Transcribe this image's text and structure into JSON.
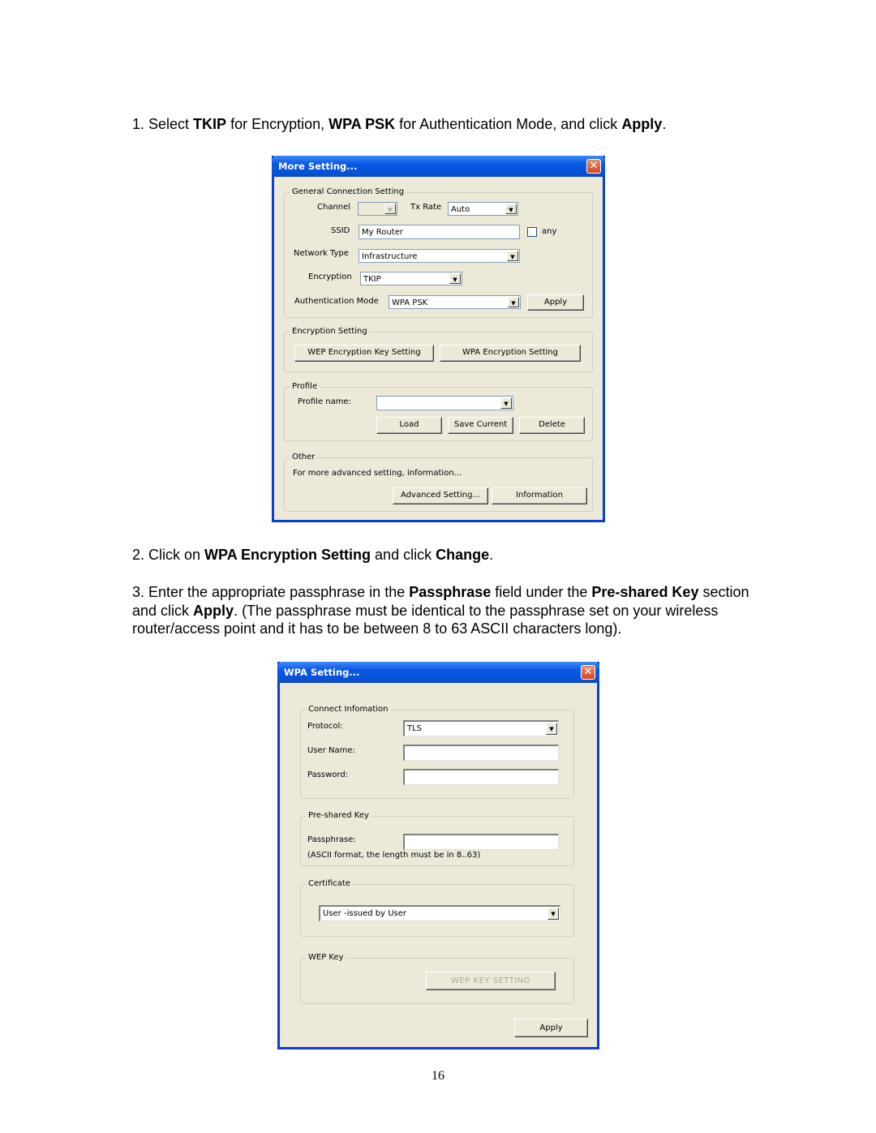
{
  "doc": {
    "step1": {
      "prefix": "1. Select ",
      "b1": "TKIP",
      "t1": " for Encryption, ",
      "b2": "WPA PSK",
      "t2": " for Authentication Mode, and click ",
      "b3": "Apply",
      "t3": "."
    },
    "step2": {
      "prefix": "2. Click on ",
      "b1": "WPA Encryption Setting",
      "t1": " and click ",
      "b2": "Change",
      "t2": "."
    },
    "step3": {
      "prefix": "3. Enter the appropriate passphrase in the ",
      "b1": "Passphrase",
      "t1": " field under the ",
      "b2": "Pre-shared Key",
      "t2": " section and click ",
      "b3": "Apply",
      "t3": ". (The passphrase must be identical to the passphrase set on your wireless router/access point and it has to be between 8 to 63 ASCII characters long)."
    },
    "page_number": "16"
  },
  "more_setting": {
    "title": "More Setting...",
    "close": "✕",
    "general": {
      "label": "General Connection Setting",
      "channel_label": "Channel",
      "channel_value": "",
      "txrate_label": "Tx Rate",
      "txrate_value": "Auto",
      "ssid_label": "SSID",
      "ssid_value": "My Router",
      "any_label": "any",
      "network_type_label": "Network Type",
      "network_type_value": "Infrastructure",
      "encryption_label": "Encryption",
      "encryption_value": "TKIP",
      "auth_label": "Authentication Mode",
      "auth_value": "WPA PSK",
      "apply": "Apply"
    },
    "encryption": {
      "label": "Encryption Setting",
      "wep_button": "WEP Encryption Key Setting",
      "wpa_button": "WPA Encryption Setting"
    },
    "profile": {
      "label": "Profile",
      "name_label": "Profile name:",
      "name_value": "",
      "load": "Load",
      "save": "Save Current",
      "delete": "Delete"
    },
    "other": {
      "label": "Other",
      "text": "For more advanced setting, information...",
      "advanced": "Advanced Setting...",
      "information": "Information"
    }
  },
  "wpa_setting": {
    "title": "WPA Setting...",
    "close": "✕",
    "connect": {
      "label": "Connect Infomation",
      "protocol_label": "Protocol:",
      "protocol_value": "TLS",
      "username_label": "User Name:",
      "username_value": "",
      "password_label": "Password:",
      "password_value": ""
    },
    "psk": {
      "label": "Pre-shared Key",
      "passphrase_label": "Passphrase:",
      "passphrase_value": "",
      "hint": "(ASCII format, the length must be in 8..63)"
    },
    "certificate": {
      "label": "Certificate",
      "value": "User -issued by User"
    },
    "wepkey": {
      "label": "WEP Key",
      "button": "WEP KEY SETTING"
    },
    "apply": "Apply"
  }
}
